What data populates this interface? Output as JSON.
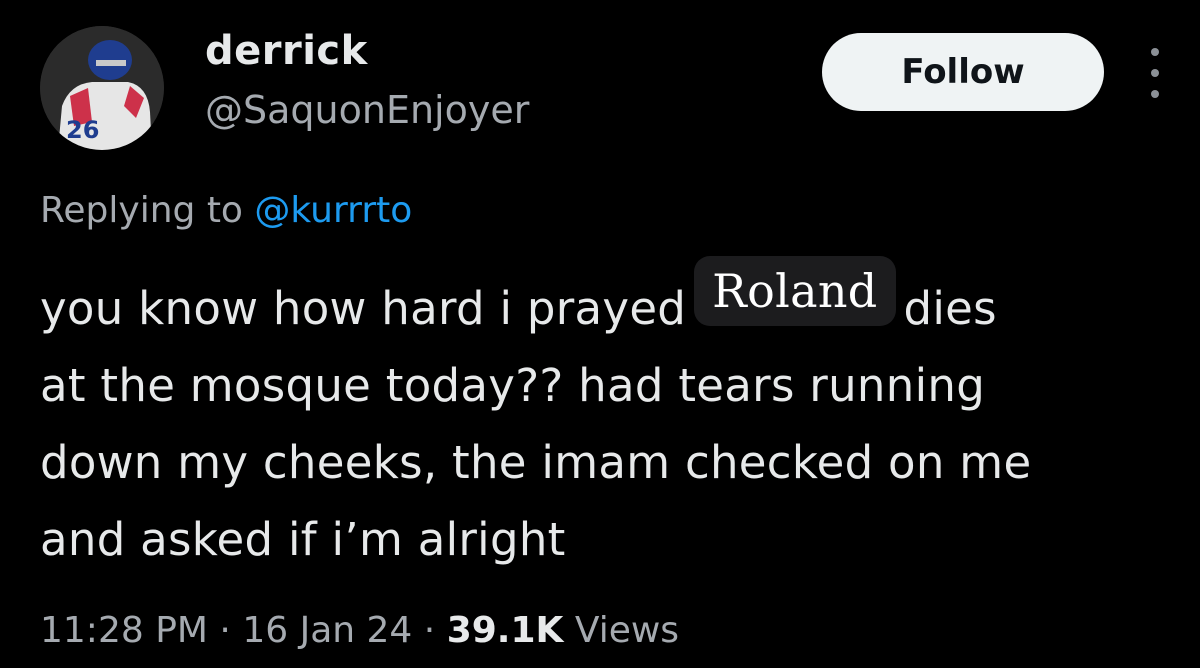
{
  "user": {
    "display_name": "derrick",
    "handle": "@SaquonEnjoyer",
    "avatar_icon": "avatar-football-player",
    "jersey_number": "26"
  },
  "follow_button": {
    "label": "Follow"
  },
  "more_menu": {
    "icon": "more-vertical-icon"
  },
  "reply": {
    "prefix": "Replying to",
    "mention": "@kurrrto"
  },
  "tweet": {
    "line1_before": "you know how hard i prayed",
    "highlighted_name": "Roland",
    "line1_after": "dies",
    "line2": "at the mosque today??  had tears running",
    "line3": "down my cheeks, the imam checked on me",
    "line4": "and asked if i’m  alright"
  },
  "meta": {
    "time": "11:28 PM",
    "date": "16 Jan 24",
    "separator": "·",
    "views_count": "39.1K",
    "views_label": "Views"
  },
  "colors": {
    "background": "#000000",
    "text": "#e7e9ea",
    "secondary_text": "#a5aab0",
    "link": "#1d9bf0",
    "follow_bg": "#eff3f4"
  }
}
